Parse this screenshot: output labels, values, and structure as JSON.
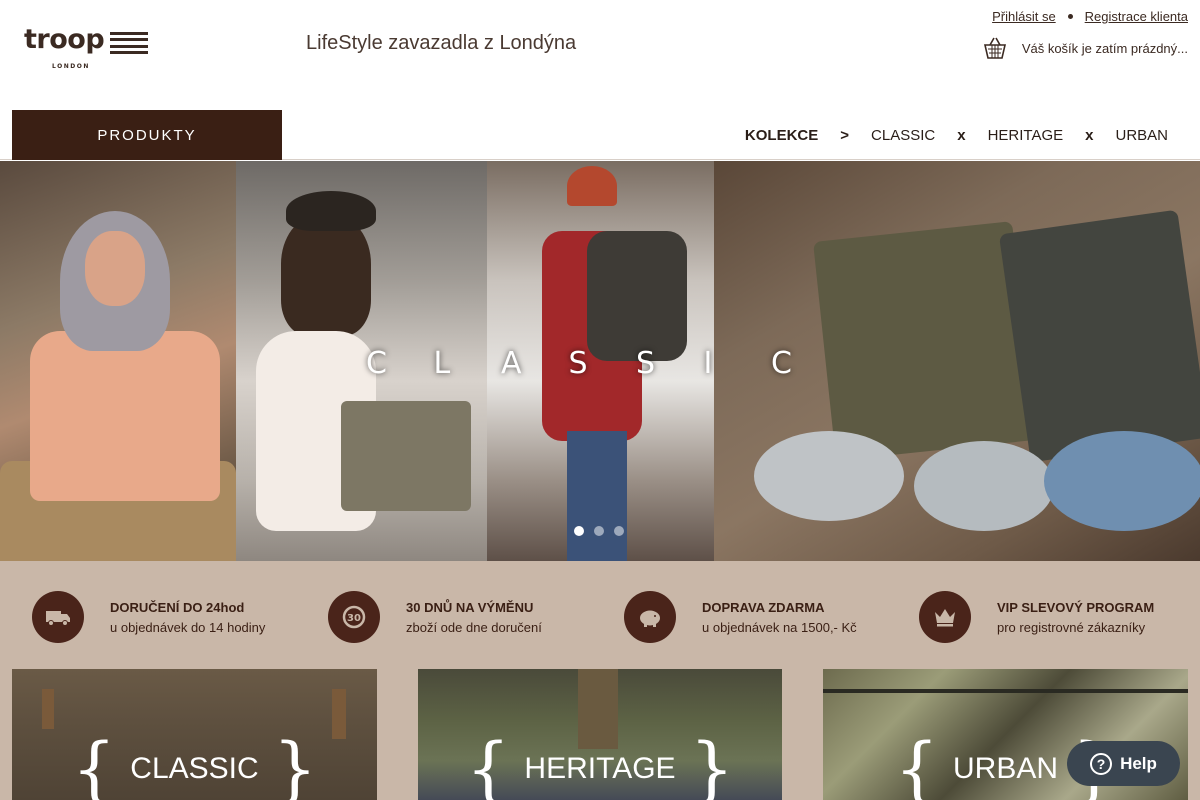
{
  "header": {
    "logo_text": "troop",
    "logo_sub": "LONDON",
    "tagline": "LifeStyle zavazadla z Londýna",
    "login_label": "Přihlásit se",
    "register_label": "Registrace klienta",
    "cart_text": "Váš košík je zatím prázdný..."
  },
  "nav": {
    "products_label": "PRODUKTY",
    "collections_label": "KOLEKCE",
    "sep_arrow": ">",
    "sep_x": "x",
    "items": [
      "CLASSIC",
      "HERITAGE",
      "URBAN"
    ]
  },
  "hero": {
    "letters": [
      "C",
      "L",
      "A",
      "S",
      "S",
      "I",
      "C"
    ],
    "slides_count": 3,
    "active_slide": 1
  },
  "benefits": [
    {
      "title": "DORUČENÍ DO 24hod",
      "subtitle": "u objednávek do 14 hodiny",
      "icon": "truck-icon"
    },
    {
      "title": "30 DNŮ NA VÝMĚNU",
      "subtitle": "zboží ode dne doručení",
      "icon": "return-30-icon"
    },
    {
      "title": "DOPRAVA ZDARMA",
      "subtitle": "u objednávek na 1500,- Kč",
      "icon": "piggy-bank-icon"
    },
    {
      "title": "VIP SLEVOVÝ PROGRAM",
      "subtitle": "pro registrovné zákazníky",
      "icon": "crown-icon"
    }
  ],
  "tiles": {
    "classic": "CLASSIC",
    "heritage": "HERITAGE",
    "urban": "URBAN",
    "open_brace": "{",
    "close_brace": "}"
  },
  "help": {
    "label": "Help",
    "icon": "help-question-icon"
  },
  "colors": {
    "brand_dark": "#3a1f14",
    "benefit_bg": "#c9b7a8",
    "help_bg": "#3a4550"
  }
}
